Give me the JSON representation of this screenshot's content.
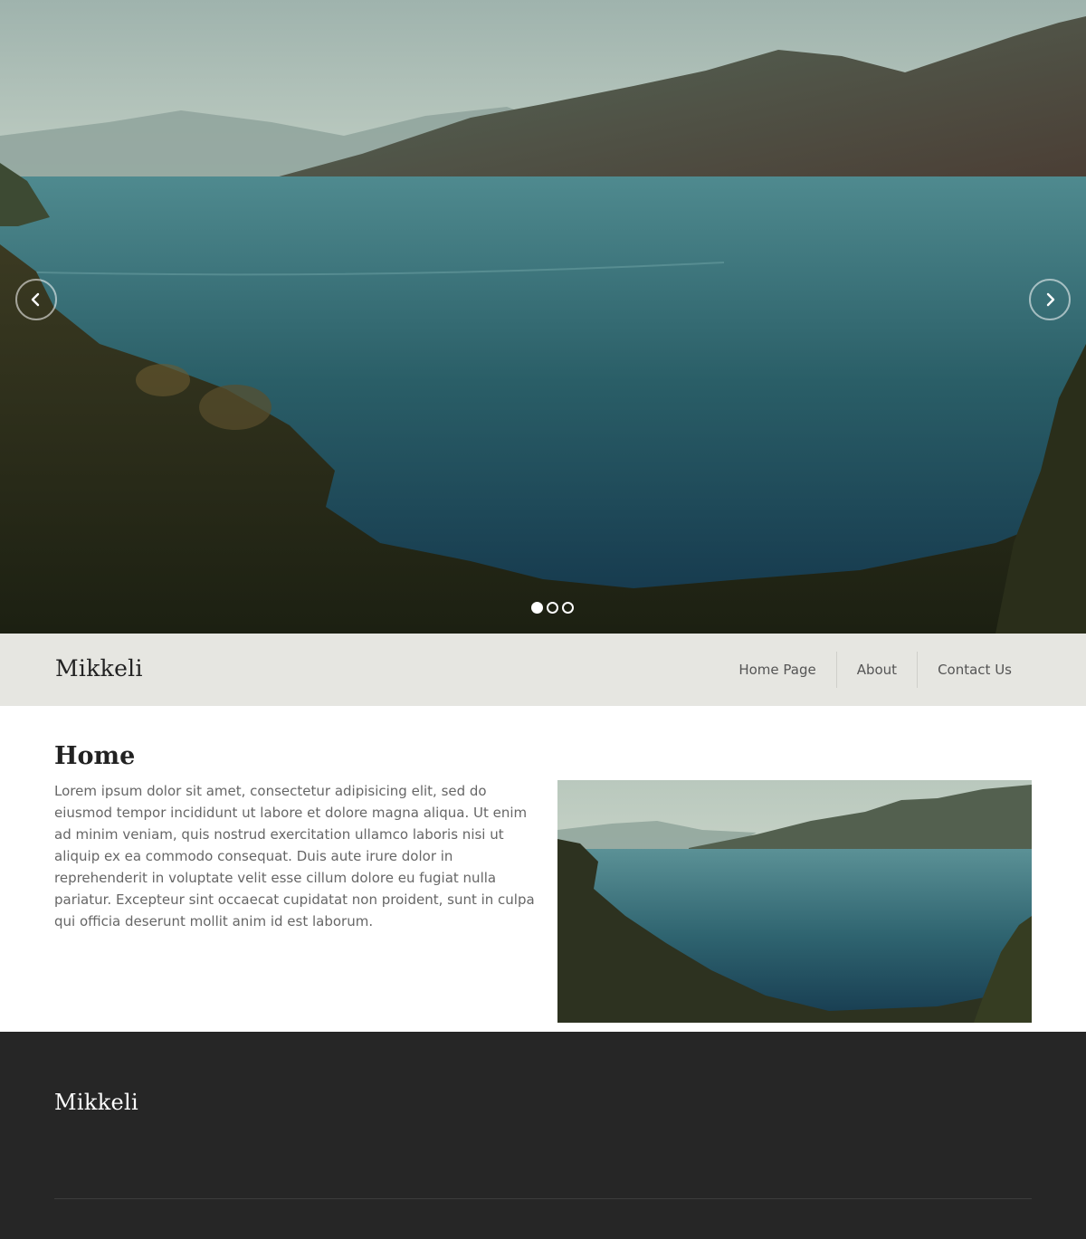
{
  "slider": {
    "image": "mountain-lake-landscape",
    "prev_icon": "chevron-left-icon",
    "next_icon": "chevron-right-icon",
    "slide_count": 3,
    "active_slide": 1
  },
  "header": {
    "brand": "Mikkeli",
    "nav": [
      {
        "label": "Home Page"
      },
      {
        "label": "About"
      },
      {
        "label": "Contact Us"
      }
    ]
  },
  "main": {
    "title": "Home",
    "body": "Lorem ipsum dolor sit amet, consectetur adipisicing elit, sed do eiusmod tempor incididunt ut labore et dolore magna aliqua. Ut enim ad minim veniam, quis nostrud exercitation ullamco laboris nisi ut aliquip ex ea commodo consequat. Duis aute irure dolor in reprehenderit in voluptate velit esse cillum dolore eu fugiat nulla pariatur. Excepteur sint occaecat cupidatat non proident, sunt in culpa qui officia deserunt mollit anim id est laborum.",
    "image": "mountain-lake-landscape"
  },
  "footer": {
    "brand": "Mikkeli"
  },
  "colors": {
    "navbar_bg": "#e6e6e1",
    "footer_bg": "#262626",
    "text": "#666666",
    "heading": "#222222"
  }
}
